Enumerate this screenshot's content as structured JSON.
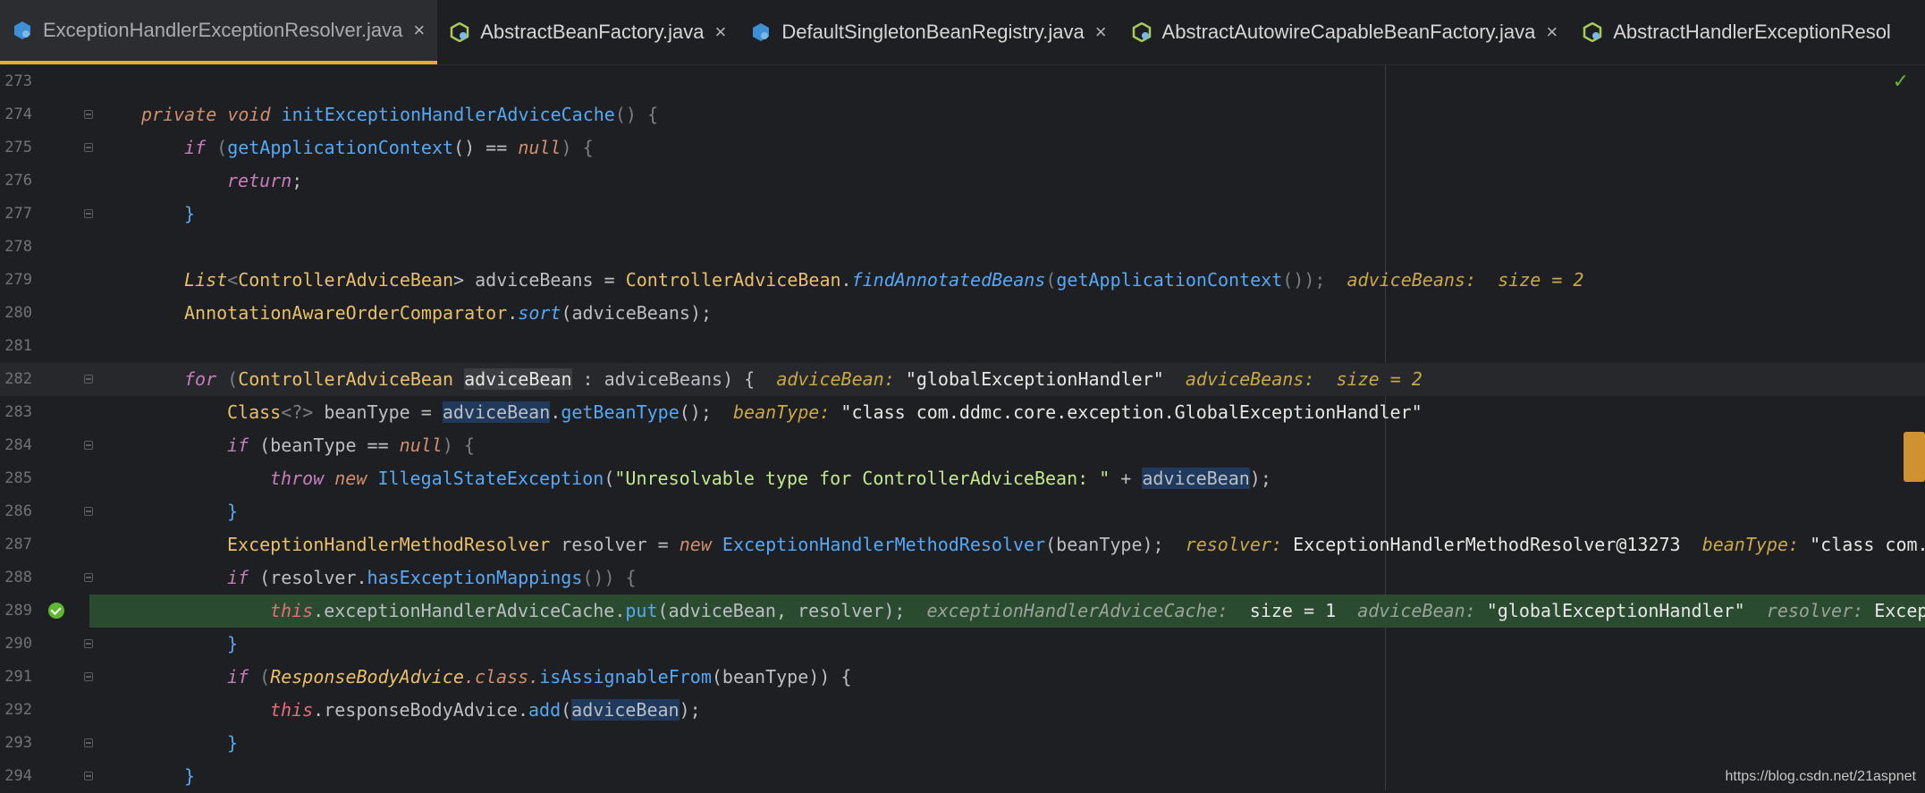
{
  "tabs": [
    {
      "label": "ExceptionHandlerExceptionResolver.java",
      "active": true,
      "icon": "java-class-icon"
    },
    {
      "label": "AbstractBeanFactory.java",
      "active": false,
      "icon": "abstract-class-icon"
    },
    {
      "label": "DefaultSingletonBeanRegistry.java",
      "active": false,
      "icon": "java-class-icon"
    },
    {
      "label": "AbstractAutowireCapableBeanFactory.java",
      "active": false,
      "icon": "abstract-class-icon"
    },
    {
      "label": "AbstractHandlerExceptionResol",
      "active": false,
      "icon": "abstract-class-icon"
    }
  ],
  "close_glyph": "×",
  "editor": {
    "line_numbers": [
      "273",
      "274",
      "275",
      "276",
      "277",
      "278",
      "279",
      "280",
      "281",
      "282",
      "283",
      "284",
      "285",
      "286",
      "287",
      "288",
      "289",
      "290",
      "291",
      "292",
      "293",
      "294"
    ],
    "line": {
      "274": {
        "a": "private",
        "b": "void",
        "c": "initExceptionHandlerAdviceCache",
        "d": "() {"
      },
      "275": {
        "a": "if",
        "b": " (",
        "c": "getApplicationContext",
        "d": "() == ",
        "e": "null",
        "f": ") {"
      },
      "276": {
        "a": "return",
        ";": ";"
      },
      "277": {
        "a": "}"
      },
      "279": {
        "a": "List",
        "b": "<",
        "c": "ControllerAdviceBean",
        "d": "> adviceBeans = ",
        "e": "ControllerAdviceBean",
        ".": ".",
        "f": "findAnnotatedBeans",
        "g": "(",
        "h": "getApplicationContext",
        "i": "());",
        "hk1": "adviceBeans:",
        "hv1": "size = 2"
      },
      "280": {
        "a": "AnnotationAwareOrderComparator",
        ".": ".",
        "b": "sort",
        "c": "(adviceBeans);"
      },
      "282": {
        "a": "for",
        "b": " (",
        "c": "ControllerAdviceBean",
        "d": "adviceBean",
        "e": " : adviceBeans) {",
        "hk1": "adviceBean:",
        "hv1": "\"globalExceptionHandler\"",
        "hk2": "adviceBeans:",
        "hv2": "size = 2"
      },
      "283": {
        "a": "Class",
        "b": "<?>",
        "c": " beanType = ",
        "d": "adviceBean",
        ".": ".",
        "e": "getBeanType",
        "f": "();",
        "hk1": "beanType:",
        "hv1": "\"class com.ddmc.core.exception.GlobalExceptionHandler\""
      },
      "284": {
        "a": "if",
        "b": " (beanType == ",
        "c": "null",
        "d": ") {"
      },
      "285": {
        "a": "throw",
        "b": "new",
        "c": "IllegalStateException",
        "d": "(",
        "e": "\"Unresolvable type for ControllerAdviceBean: \"",
        "f": " + ",
        "g": "adviceBean",
        "h": ");"
      },
      "286": {
        "a": "}"
      },
      "287": {
        "a": "ExceptionHandlerMethodResolver",
        "b": " resolver = ",
        "c": "new",
        "d": "ExceptionHandlerMethodResolver",
        "e": "(beanType);",
        "hk1": "resolver:",
        "hv1": "ExceptionHandlerMethodResolver@13273",
        "hk2": "beanType:",
        "hv2": "\"class com."
      },
      "288": {
        "a": "if",
        "b": " (resolver.",
        "c": "hasExceptionMappings",
        "d": "()) {"
      },
      "289": {
        "a": "this",
        ".": ".",
        "b": "exceptionHandlerAdviceCache.",
        "c": "put",
        "d": "(adviceBean, resolver);",
        "hk1": "exceptionHandlerAdviceCache:",
        "hv1": "size = 1",
        "hk2": "adviceBean:",
        "hv2": "\"globalExceptionHandler\"",
        "hk3": "resolver:",
        "hv3": "Excep"
      },
      "290": {
        "a": "}"
      },
      "291": {
        "a": "if",
        "b": " (",
        "c": "ResponseBodyAdvice",
        "d": ".class.",
        "e": "isAssignableFrom",
        "f": "(beanType)) {"
      },
      "292": {
        "a": "this",
        ".": ".",
        "b": "responseBodyAdvice.",
        "c": "add",
        "d": "(",
        "e": "adviceBean",
        "f": ");"
      },
      "293": {
        "a": "}"
      },
      "294": {
        "a": "}"
      }
    }
  },
  "watermark": "https://blog.csdn.net/21aspnet",
  "status_ok_glyph": "✓",
  "colors": {
    "accent": "#f0a732",
    "breakpoint": "#5fb832",
    "exec_line": "#2a4b2f"
  }
}
